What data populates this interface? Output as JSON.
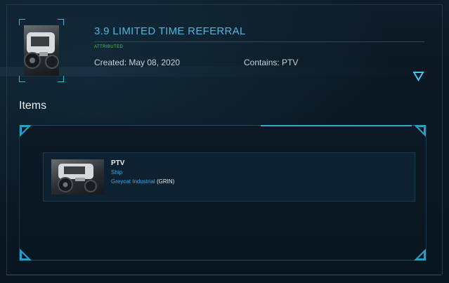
{
  "pledge": {
    "title": "3.9 LIMITED TIME REFERRAL",
    "status": "ATTRIBUTED",
    "created": "Created: May 08, 2020",
    "contains": "Contains: PTV",
    "thumbnail_icon": "ptv-ship-image"
  },
  "items_section": {
    "heading": "Items",
    "items": [
      {
        "name": "PTV",
        "type": "Ship",
        "manufacturer": "Greycat Industrial",
        "manufacturer_code": "GRIN",
        "thumbnail_icon": "ptv-ship-image"
      }
    ]
  },
  "colors": {
    "accent": "#4fb4e0",
    "status_green": "#3ed23e",
    "link_blue": "#39a8dc"
  }
}
